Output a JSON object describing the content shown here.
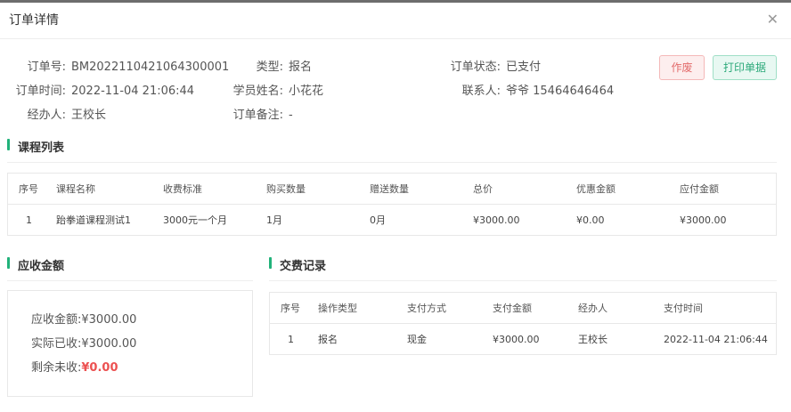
{
  "dialog": {
    "title": "订单详情",
    "close_icon": "close-icon"
  },
  "order_info": {
    "order_no_label": "订单号:",
    "order_no": "BM2022110421064300001",
    "type_label": "类型:",
    "type": "报名",
    "status_label": "订单状态:",
    "status": "已支付",
    "time_label": "订单时间:",
    "time": "2022-11-04 21:06:44",
    "student_label": "学员姓名:",
    "student": "小花花",
    "contact_label": "联系人:",
    "contact": "爷爷  15464646464",
    "handler_label": "经办人:",
    "handler": "王校长",
    "remark_label": "订单备注:",
    "remark": "-"
  },
  "actions": {
    "void_label": "作废",
    "print_label": "打印单据"
  },
  "courses": {
    "title": "课程列表",
    "headers": [
      "序号",
      "课程名称",
      "收费标准",
      "购买数量",
      "赠送数量",
      "总价",
      "优惠金额",
      "应付金额"
    ],
    "rows": [
      [
        "1",
        "跆拳道课程测试1",
        "3000元一个月",
        "1月",
        "0月",
        "¥3000.00",
        "¥0.00",
        "¥3000.00"
      ]
    ]
  },
  "receivable": {
    "title": "应收金额",
    "due_label": "应收金额:",
    "due": "¥3000.00",
    "paid_label": "实际已收:",
    "paid": "¥3000.00",
    "remain_label": "剩余未收:",
    "remain": "¥0.00"
  },
  "payments": {
    "title": "交费记录",
    "headers": [
      "序号",
      "操作类型",
      "支付方式",
      "支付金额",
      "经办人",
      "支付时间"
    ],
    "rows": [
      [
        "1",
        "报名",
        "现金",
        "¥3000.00",
        "王校长",
        "2022-11-04 21:06:44"
      ]
    ]
  },
  "colors": {
    "accent": "#21b27a",
    "danger": "#ec5151"
  }
}
